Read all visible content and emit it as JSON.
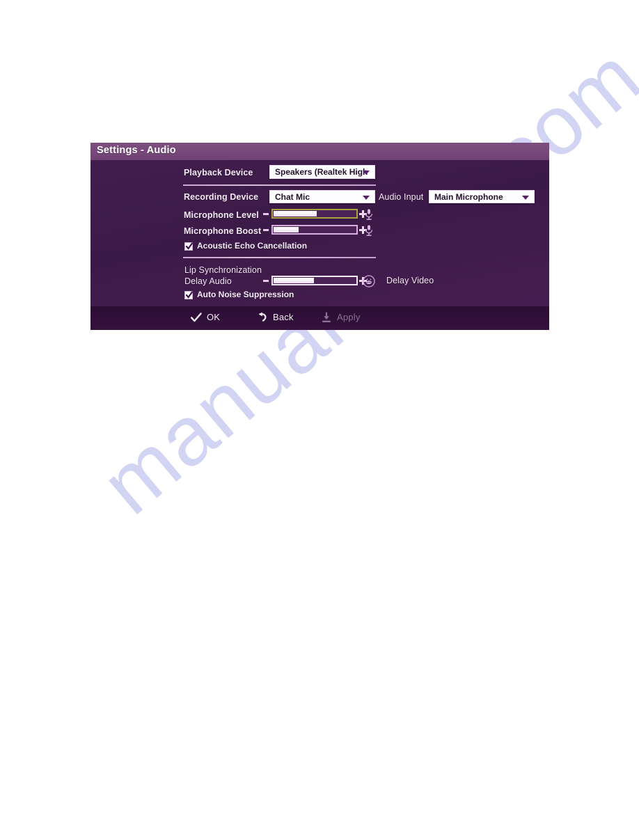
{
  "watermark": {
    "text": "manualshive.com"
  },
  "dialog": {
    "title": "Settings - Audio",
    "colors": {
      "titlebar": "#76497a",
      "body": "#3c1a47",
      "footer": "#2c0d34",
      "field_bg": "#fdfcff",
      "separator": "#e0bfe7",
      "level_track_border": "#a8a33c",
      "boost_track_border": "#d6afdd",
      "delay_track_border": "#f3e8f6"
    },
    "rows": {
      "playback_device": {
        "label": "Playback Device",
        "value": "Speakers (Realtek High",
        "icon": "chevron-down-icon"
      },
      "recording_device": {
        "label": "Recording Device",
        "value": "Chat Mic",
        "icon": "chevron-down-icon"
      },
      "audio_input": {
        "label": "Audio Input",
        "value": "Main Microphone",
        "icon": "chevron-down-icon"
      },
      "microphone_level": {
        "label": "Microphone Level",
        "minus": "-",
        "plus": "+",
        "fill_percent": 53,
        "icon": "microphone-icon"
      },
      "microphone_boost": {
        "label": "Microphone Boost",
        "minus": "-",
        "plus": "+",
        "fill_percent": 32,
        "icon": "microphone-icon"
      },
      "acoustic_echo_cancellation": {
        "label": "Acoustic Echo Cancellation",
        "checked": true
      },
      "lip_synchronization": {
        "label": "Lip Synchronization"
      },
      "delay_audio": {
        "label": "Delay Audio",
        "minus": "-",
        "plus": "+",
        "fill_percent": 50,
        "icon": "lip-sync-face-icon",
        "right_label": "Delay Video"
      },
      "auto_noise_suppression": {
        "label": "Auto Noise Suppression",
        "checked": true
      }
    },
    "footer": {
      "buttons": [
        {
          "label": "OK",
          "icon": "checkmark-icon",
          "enabled": true
        },
        {
          "label": "Back",
          "icon": "back-arrow-icon",
          "enabled": true
        },
        {
          "label": "Apply",
          "icon": "apply-download-icon",
          "enabled": false
        }
      ]
    }
  }
}
